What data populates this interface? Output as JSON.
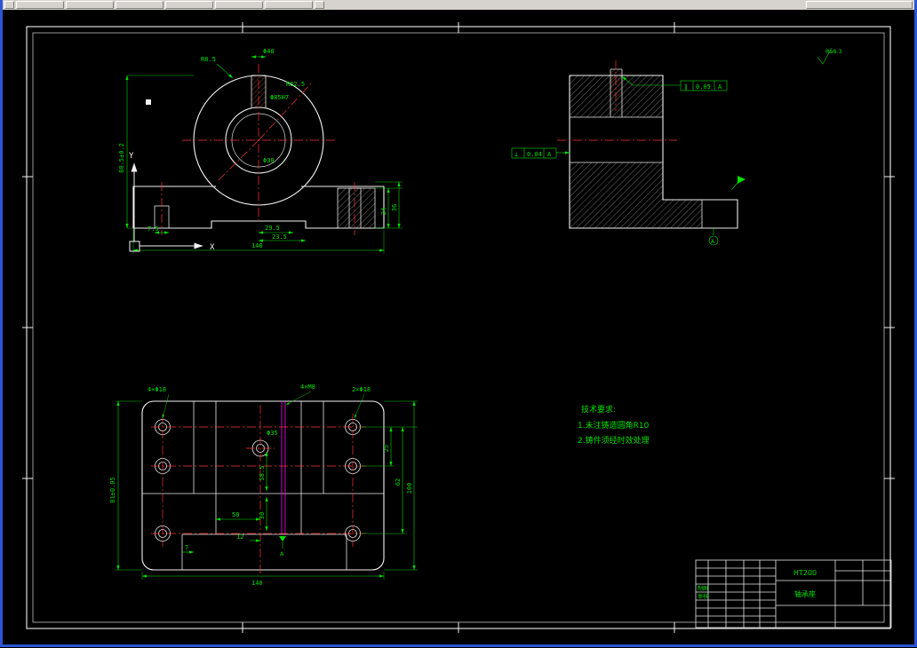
{
  "front_view": {
    "dims": [
      "R8.5",
      "Φ48",
      "R62.5",
      "Φ85H7",
      "Φ38",
      "88.5±0.2",
      "29.5",
      "23.5",
      "140",
      "7.5",
      "24",
      "36"
    ],
    "axis_x": "X",
    "axis_y": "Y"
  },
  "side_view": {
    "fcf_left": {
      "sym": "⊥",
      "tol": "0.04",
      "datum": "A"
    },
    "fcf_right": {
      "sym": "∥",
      "tol": "0.05",
      "datum": "A"
    },
    "roughness": "Ra6.3",
    "datum_label": "A"
  },
  "plan_view": {
    "dims": [
      "4×Φ18",
      "Φ35",
      "4×M8",
      "2×Φ18",
      "81±0.05",
      "25",
      "62",
      "100",
      "58.5",
      "30",
      "50",
      "12",
      "7",
      "140"
    ],
    "datum_label": "A"
  },
  "tech_requirements": {
    "title": "技术要求:",
    "items": [
      "1.未注铸造圆角R10",
      "2.铸件须经时效处理"
    ]
  },
  "title_block": {
    "material": "HT200",
    "part_name": "轴承座",
    "left_labels": [
      "制图",
      "审核"
    ]
  },
  "colors": {
    "dimension": "#00e000",
    "centerline": "#ff3434",
    "outline": "#f2f2f2",
    "auxiliary": "#ff00ff"
  }
}
